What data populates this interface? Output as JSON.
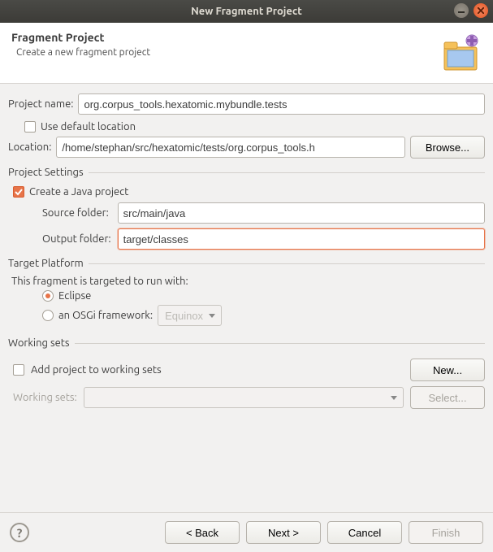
{
  "window": {
    "title": "New Fragment Project"
  },
  "header": {
    "title": "Fragment Project",
    "subtitle": "Create a new fragment project"
  },
  "projectName": {
    "label": "Project name:",
    "value": "org.corpus_tools.hexatomic.mybundle.tests"
  },
  "location": {
    "useDefaultLabel": "Use default location",
    "useDefaultChecked": false,
    "label": "Location:",
    "value": "/home/stephan/src/hexatomic/tests/org.corpus_tools.h",
    "browseLabel": "Browse..."
  },
  "projectSettings": {
    "legend": "Project Settings",
    "createJavaLabel": "Create a Java project",
    "createJavaChecked": true,
    "sourceFolderLabel": "Source folder:",
    "sourceFolderValue": "src/main/java",
    "outputFolderLabel": "Output folder:",
    "outputFolderValue": "target/classes"
  },
  "targetPlatform": {
    "legend": "Target Platform",
    "description": "This fragment is targeted to run with:",
    "eclipseLabel": "Eclipse",
    "osgiLabel": "an OSGi framework:",
    "selected": "eclipse",
    "osgiFrameworkValue": "Equinox"
  },
  "workingSets": {
    "legend": "Working sets",
    "addLabel": "Add project to working sets",
    "addChecked": false,
    "newLabel": "New...",
    "workingSetsLabel": "Working sets:",
    "selectLabel": "Select..."
  },
  "buttons": {
    "back": "< Back",
    "next": "Next >",
    "cancel": "Cancel",
    "finish": "Finish"
  }
}
